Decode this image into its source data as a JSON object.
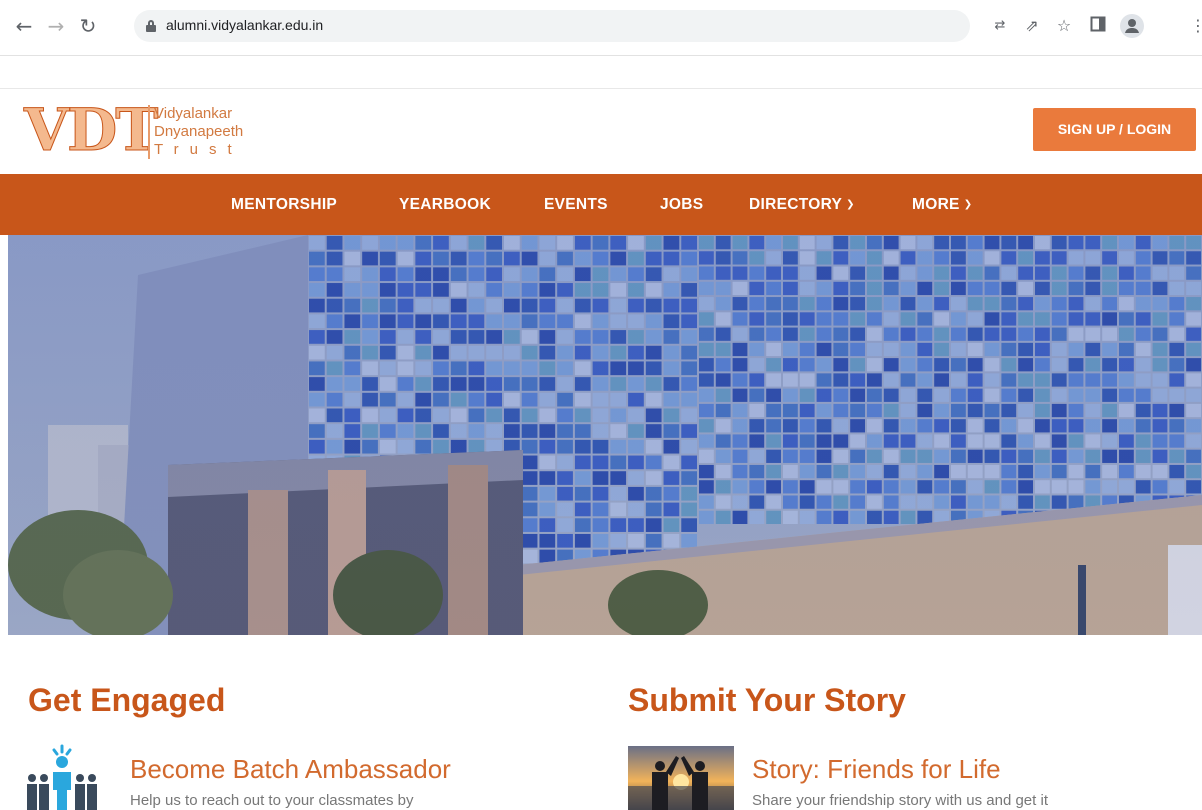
{
  "browser": {
    "url": "alumni.vidyalankar.edu.in",
    "icons": [
      "back-arrow-icon",
      "forward-arrow-icon",
      "reload-icon",
      "lock-icon",
      "translate-icon",
      "share-icon",
      "star-icon",
      "side-panel-icon",
      "profile-icon",
      "menu-icon"
    ]
  },
  "header": {
    "logo": {
      "mark": "VDT",
      "line1": "Vidyalankar",
      "line2": "Dnyanapeeth",
      "line3": "Trust"
    },
    "signup_label": "SIGN UP / LOGIN"
  },
  "nav": {
    "items": [
      {
        "label": "MENTORSHIP"
      },
      {
        "label": "YEARBOOK"
      },
      {
        "label": "EVENTS"
      },
      {
        "label": "JOBS"
      },
      {
        "label": "DIRECTORY",
        "dropdown": true
      },
      {
        "label": "MORE",
        "dropdown": true
      }
    ]
  },
  "colors": {
    "brand": "#c8561a",
    "button": "#ea7a3c",
    "title": "#d26a2e"
  },
  "sections": {
    "get_engaged": {
      "title": "Get Engaged",
      "card_title": "Become Batch Ambassador",
      "card_desc": "Help us to reach out to your classmates by"
    },
    "submit_story": {
      "title": "Submit Your Story",
      "card_title": "Story: Friends for Life",
      "card_desc": "Share your friendship story with us and get it"
    }
  }
}
